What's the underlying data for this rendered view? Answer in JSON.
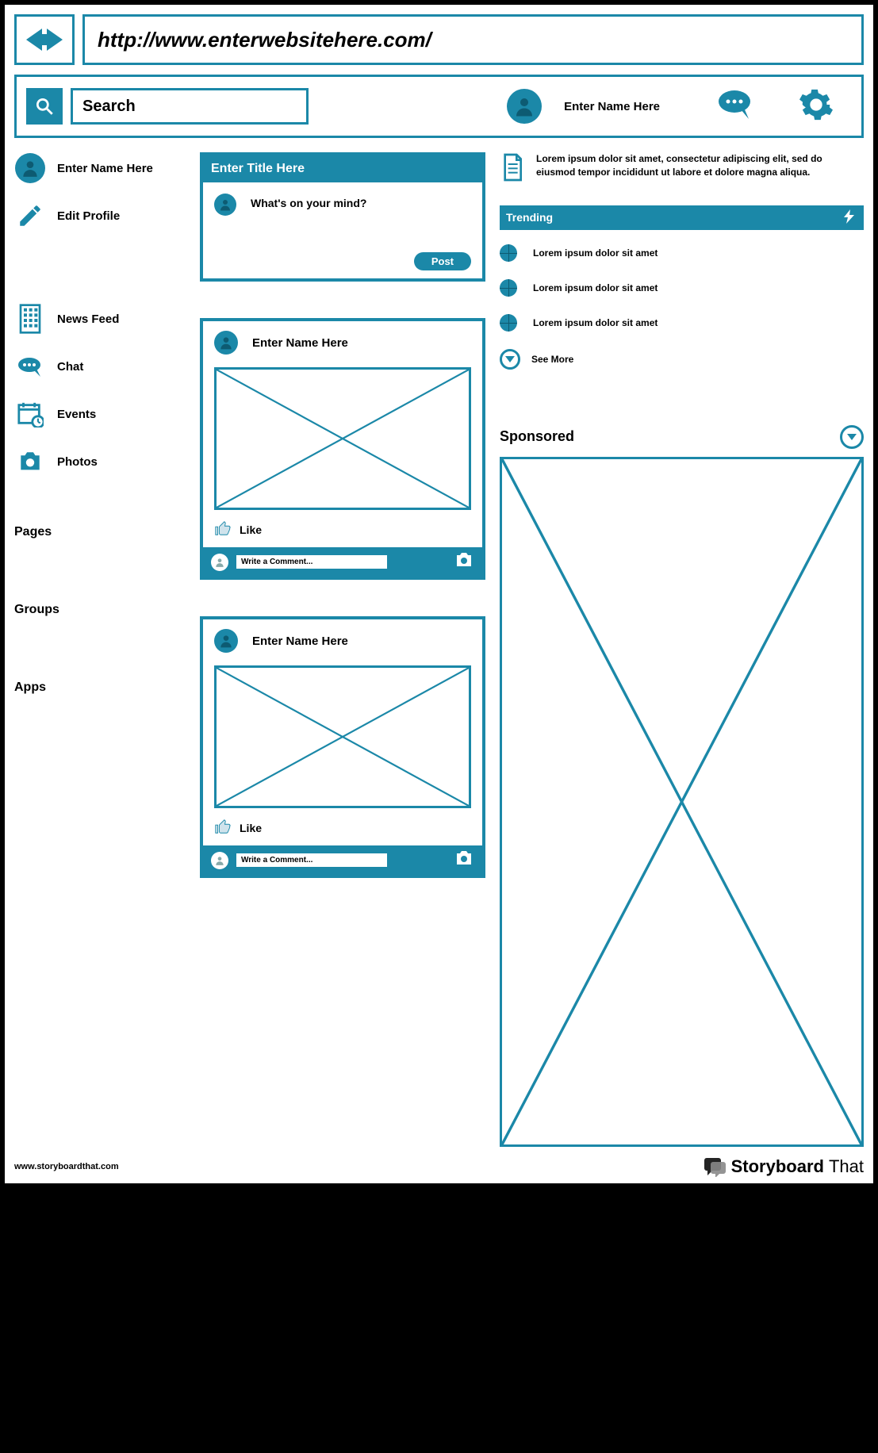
{
  "url": "http://www.enterwebsitehere.com/",
  "toolbar": {
    "search_placeholder": "Search",
    "user_name": "Enter Name Here"
  },
  "sidebar": {
    "profile_name": "Enter Name Here",
    "edit_profile": "Edit Profile",
    "items": [
      {
        "label": "News Feed"
      },
      {
        "label": "Chat"
      },
      {
        "label": "Events"
      },
      {
        "label": "Photos"
      }
    ],
    "sections": [
      "Pages",
      "Groups",
      "Apps"
    ]
  },
  "compose": {
    "title": "Enter Title Here",
    "prompt": "What's on your mind?",
    "post_label": "Post"
  },
  "posts": [
    {
      "author": "Enter Name Here",
      "like_label": "Like",
      "comment_placeholder": "Write a Comment..."
    },
    {
      "author": "Enter Name Here",
      "like_label": "Like",
      "comment_placeholder": "Write a Comment..."
    }
  ],
  "right": {
    "note_text": "Lorem ipsum dolor sit amet, consectetur adipiscing elit, sed do eiusmod tempor incididunt ut labore et dolore magna aliqua.",
    "trending_label": "Trending",
    "trending_items": [
      "Lorem ipsum dolor sit amet",
      "Lorem ipsum dolor sit amet",
      "Lorem ipsum dolor sit amet"
    ],
    "see_more": "See More",
    "sponsored": "Sponsored"
  },
  "footer": {
    "url": "www.storyboardthat.com",
    "brand1": "Storyboard",
    "brand2": "That"
  }
}
